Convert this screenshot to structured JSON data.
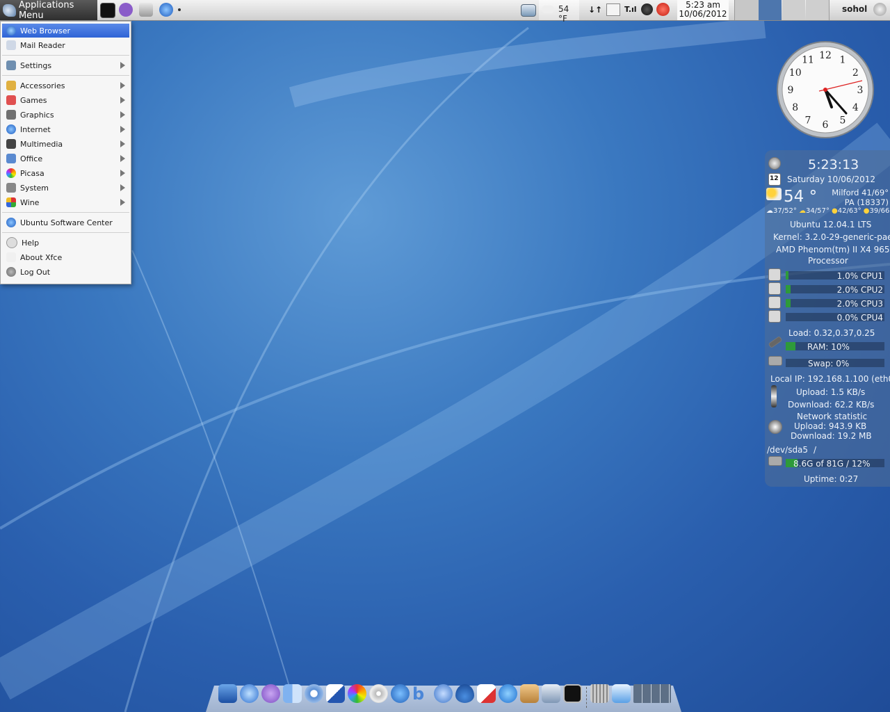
{
  "panel": {
    "app_menu_label": "Applications Menu",
    "weather_temp": "54 °F",
    "clock_time": "5:23 am",
    "clock_date": "10/06/2012",
    "user": "sohol"
  },
  "menu": {
    "items": [
      {
        "label": "Web Browser"
      },
      {
        "label": "Mail Reader"
      },
      {
        "label": "Settings"
      },
      {
        "label": "Accessories"
      },
      {
        "label": "Games"
      },
      {
        "label": "Graphics"
      },
      {
        "label": "Internet"
      },
      {
        "label": "Multimedia"
      },
      {
        "label": "Office"
      },
      {
        "label": "Picasa"
      },
      {
        "label": "System"
      },
      {
        "label": "Wine"
      },
      {
        "label": "Ubuntu Software Center"
      },
      {
        "label": "Help"
      },
      {
        "label": "About Xfce"
      },
      {
        "label": "Log Out"
      }
    ]
  },
  "clock_widget": {
    "numbers": [
      "12",
      "1",
      "2",
      "3",
      "4",
      "5",
      "6",
      "7",
      "8",
      "9",
      "10",
      "11"
    ]
  },
  "conky": {
    "time": "5:23:13",
    "calendar_day": "12",
    "date": "Saturday 10/06/2012",
    "temp": "54 °",
    "location_line1": "Milford 41/69°",
    "location_line2": "PA (18337)",
    "forecast": [
      "37/52°",
      "34/57°",
      "42/63°",
      "39/66°"
    ],
    "os": "Ubuntu 12.04.1 LTS",
    "kernel": "Kernel: 3.2.0-29-generic-pae",
    "cpu_name_1": "AMD Phenom(tm) II X4 965",
    "cpu_name_2": "Processor",
    "cpus": [
      {
        "label": "1.0% CPU1",
        "usage": 0.01
      },
      {
        "label": "2.0% CPU2",
        "usage": 0.02
      },
      {
        "label": "2.0% CPU3",
        "usage": 0.02
      },
      {
        "label": "0.0% CPU4",
        "usage": 0.0
      }
    ],
    "load": "Load: 0.32,0.37,0.25",
    "ram": "RAM: 10%",
    "ram_usage": 0.1,
    "swap": "Swap: 0%",
    "local_ip": "Local IP: 192.168.1.100 (eth0)",
    "upload": "Upload: 1.5 KB/s",
    "download": "Download: 62.2 KB/s",
    "net_stat_title": "Network statistic",
    "net_stat_upload": "Upload: 943.9 KB",
    "net_stat_download": "Download: 19.2 MB",
    "disk_dev": "/dev/sda5",
    "disk_mount": "/",
    "disk_usage_text": "8.6G of 81G / 12%",
    "disk_usage": 0.12,
    "uptime": "Uptime: 0:27"
  },
  "colors": {
    "selected_item": "#2f63d6",
    "bar_fill": "#2e9a3a"
  }
}
